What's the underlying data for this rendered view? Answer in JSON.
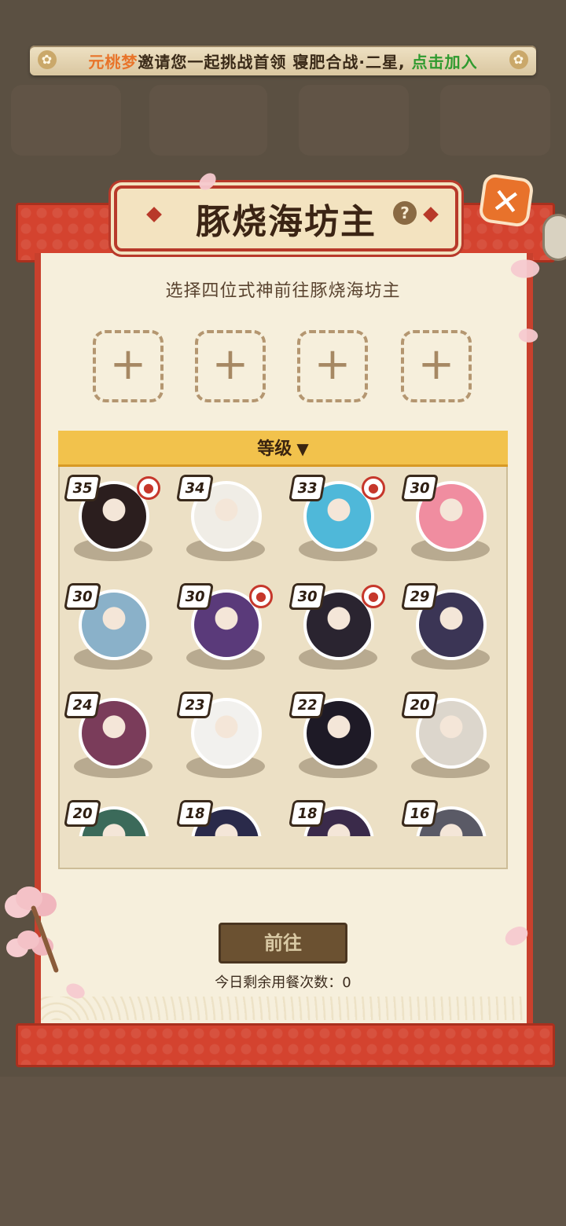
{
  "invite": {
    "name": "元桃梦",
    "text": "邀请您一起挑战首领 寝肥合战·二星,",
    "join": "点击加入"
  },
  "panel": {
    "title": "豚烧海坊主",
    "help": "?",
    "close": "✕",
    "subtitle": "选择四位式神前往豚烧海坊主"
  },
  "slots": [
    {
      "label": "+"
    },
    {
      "label": "+"
    },
    {
      "label": "+"
    },
    {
      "label": "+"
    }
  ],
  "sort": {
    "label": "等级",
    "icon": "chevron-down-icon"
  },
  "shikigami": [
    {
      "level": "35",
      "badge": "hat-icon",
      "color": "#2b1e1e"
    },
    {
      "level": "34",
      "badge": "",
      "color": "#f0ede6"
    },
    {
      "level": "33",
      "badge": "leaf-icon",
      "color": "#4fb8d9"
    },
    {
      "level": "30",
      "badge": "",
      "color": "#f08da0"
    },
    {
      "level": "30",
      "badge": "",
      "color": "#8ab1c9"
    },
    {
      "level": "30",
      "badge": "flag-icon",
      "color": "#5a3a7a"
    },
    {
      "level": "30",
      "badge": "link-icon",
      "color": "#2a2430"
    },
    {
      "level": "29",
      "badge": "",
      "color": "#3b3555"
    },
    {
      "level": "24",
      "badge": "",
      "color": "#7a3c5a"
    },
    {
      "level": "23",
      "badge": "",
      "color": "#f2f1ee"
    },
    {
      "level": "22",
      "badge": "",
      "color": "#1e1a26"
    },
    {
      "level": "20",
      "badge": "",
      "color": "#dcd6cc"
    },
    {
      "level": "20",
      "badge": "",
      "color": "#3b6a5a"
    },
    {
      "level": "18",
      "badge": "",
      "color": "#2a2a4a"
    },
    {
      "level": "18",
      "badge": "",
      "color": "#3a2a4a"
    },
    {
      "level": "16",
      "badge": "",
      "color": "#5a5a66"
    }
  ],
  "footer": {
    "go": "前往",
    "remaining": "今日剩余用餐次数：0"
  }
}
